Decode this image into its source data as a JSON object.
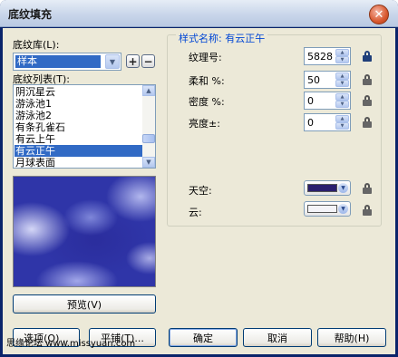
{
  "window": {
    "title": "底纹填充",
    "close_glyph": "✕"
  },
  "library": {
    "label": "底纹库(L):",
    "selected": "样本",
    "add_glyph": "+",
    "remove_glyph": "−"
  },
  "texture_list": {
    "label": "底纹列表(T):",
    "items": [
      "阴沉星云",
      "游泳池1",
      "游泳池2",
      "有条孔雀石",
      "有云上午",
      "有云正午",
      "月球表面"
    ],
    "selected_index": 5
  },
  "preview_button": "预览(V)",
  "style_group": {
    "title": "样式名称: 有云正午",
    "texture_no": {
      "label": "纹理号:",
      "value": "5828"
    },
    "softness": {
      "label": "柔和 %:",
      "value": "50"
    },
    "density": {
      "label": "密度 %:",
      "value": "0"
    },
    "brightness": {
      "label": "亮度±:",
      "value": "0"
    },
    "sky": {
      "label": "天空:",
      "color": "#2b1f6e"
    },
    "cloud": {
      "label": "云:",
      "color": "#f4f4f8"
    }
  },
  "buttons": {
    "options": "选项(O)...",
    "tiling": "平铺(T)...",
    "ok": "确定",
    "cancel": "取消",
    "help": "帮助(H)"
  },
  "watermark": "思缘论坛 www.missyuan.com"
}
